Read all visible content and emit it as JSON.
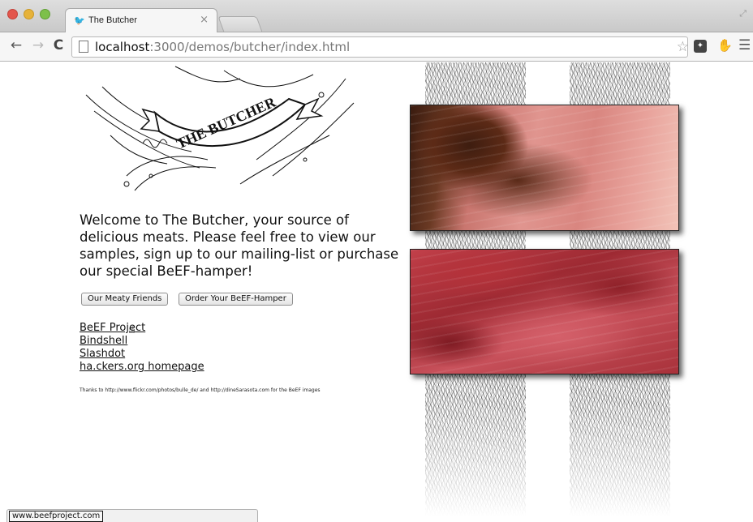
{
  "browser": {
    "tab_title": "The Butcher",
    "tab_close": "×",
    "url_host": "localhost",
    "url_path": ":3000/demos/butcher/index.html"
  },
  "page": {
    "logo_text": "THE BUTCHER",
    "welcome": "Welcome to The Butcher, your source of delicious meats. Please feel free to view our samples, sign up to our mailing-list or purchase our special BeEF-hamper!",
    "buttons": [
      {
        "label": "Our Meaty Friends"
      },
      {
        "label": "Order Your BeEF-Hamper"
      }
    ],
    "links": [
      {
        "label": "BeEF Project"
      },
      {
        "label": "Bindshell"
      },
      {
        "label": "Slashdot"
      },
      {
        "label": "ha.ckers.org homepage"
      }
    ],
    "thanks": "Thanks to http://www.flickr.com/photos/bulle_de/ and http://dineSarasota.com for the BeEF images"
  },
  "status": {
    "text": "www.beefproject.com"
  },
  "icons": {
    "tab_favicon": "bird-icon",
    "cursor": "hand-pointer-icon"
  }
}
